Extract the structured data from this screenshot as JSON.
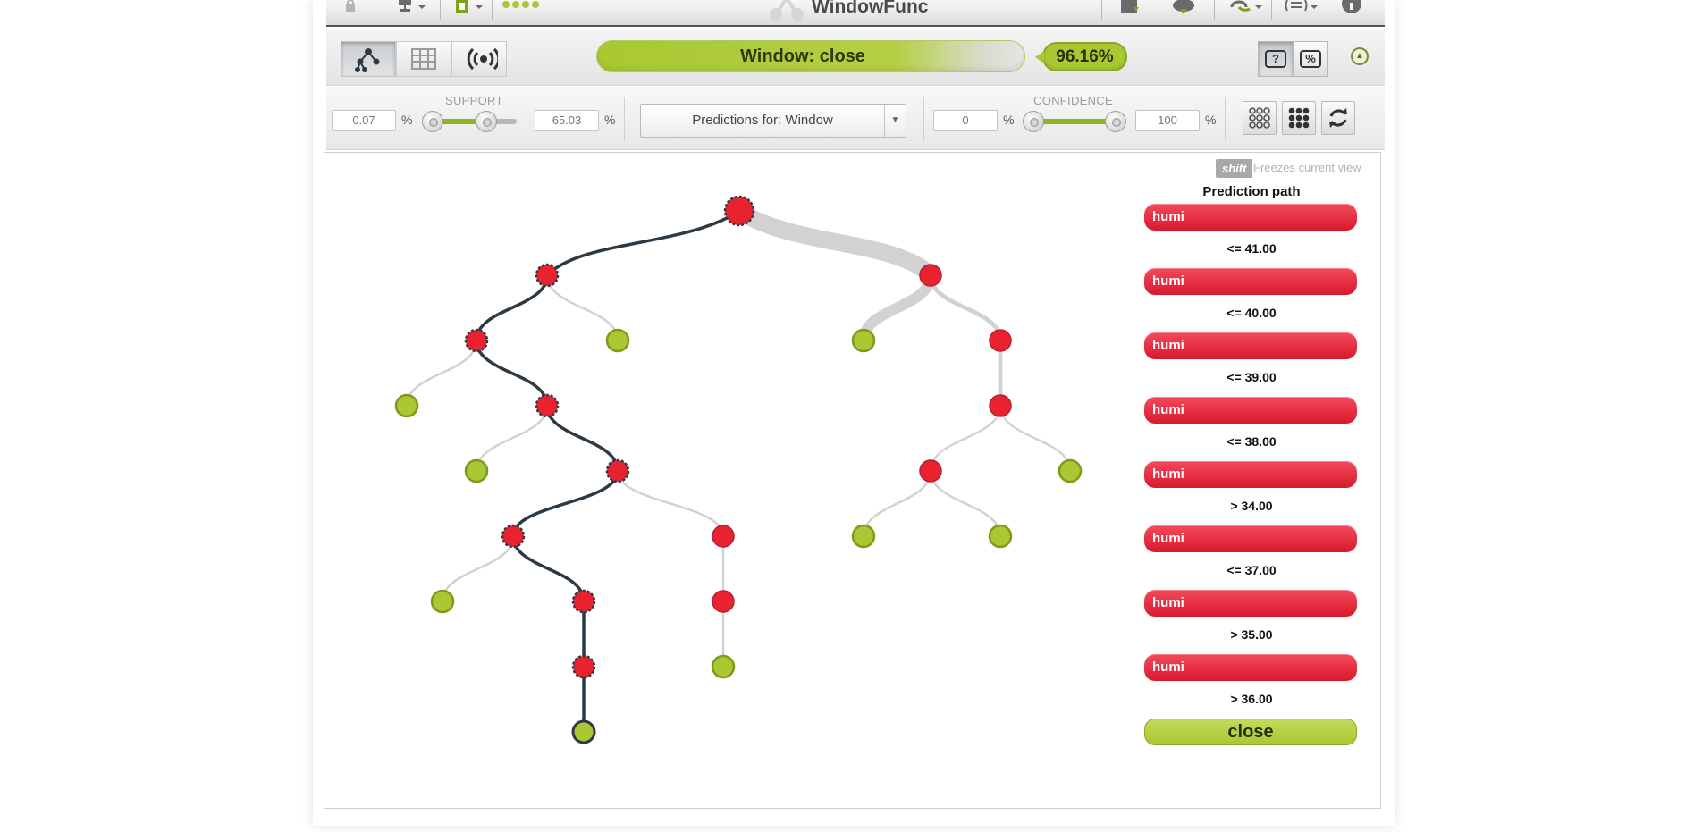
{
  "app": {
    "model_title": "WindowFunc"
  },
  "toolbar": {
    "left_icons": [
      "lock-icon",
      "network-icon",
      "dataset-icon"
    ],
    "right_icons": [
      "download-icon",
      "cloud-download-icon",
      "refresh-link-icon",
      "list-icon",
      "info-icon"
    ]
  },
  "prediction": {
    "label": "Window: close",
    "confidence": "96.16%"
  },
  "filters": {
    "support": {
      "title": "SUPPORT",
      "min": "0.07",
      "max": "65.03",
      "unit": "%"
    },
    "prediction_select": "Predictions for: Window",
    "confidence": {
      "title": "CONFIDENCE",
      "min": "0",
      "max": "100",
      "unit": "%"
    }
  },
  "hint": {
    "key": "shift",
    "text": "Freezes current view"
  },
  "prediction_path": {
    "title": "Prediction path",
    "steps": [
      {
        "field": "humi",
        "condition": "<= 41.00"
      },
      {
        "field": "humi",
        "condition": "<= 40.00"
      },
      {
        "field": "humi",
        "condition": "<= 39.00"
      },
      {
        "field": "humi",
        "condition": "<= 38.00"
      },
      {
        "field": "humi",
        "condition": "> 34.00"
      },
      {
        "field": "humi",
        "condition": "<= 37.00"
      },
      {
        "field": "humi",
        "condition": "> 35.00"
      },
      {
        "field": "humi",
        "condition": "> 36.00"
      }
    ],
    "leaf": "close"
  },
  "colors": {
    "split_node": "#e8232f",
    "leaf_node": "#a9c832",
    "path_edge": "#2d3a44",
    "other_edge": "#d2d2d2"
  }
}
